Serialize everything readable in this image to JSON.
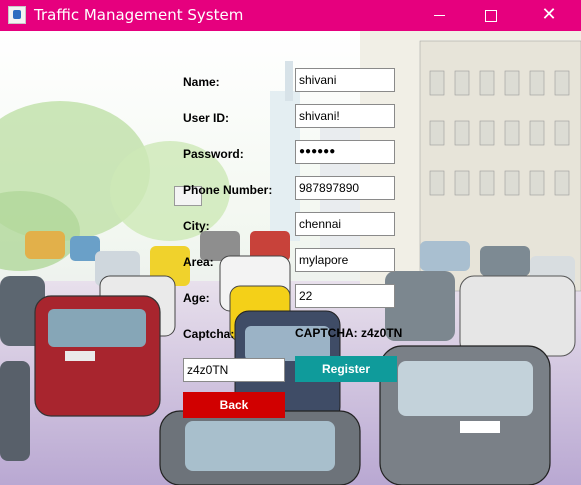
{
  "window": {
    "title": "Traffic Management System",
    "app_icon": "java-cup-icon",
    "controls": {
      "minimize": "minimize-icon",
      "maximize": "maximize-icon",
      "close": "close-icon",
      "close_glyph": "✕"
    },
    "title_bar_color": "#e6007e"
  },
  "form": {
    "name": {
      "label": "Name:",
      "value": "shivani"
    },
    "user_id": {
      "label": "User ID:",
      "value": "shivani!"
    },
    "password": {
      "label": "Password:",
      "value": "●●●●●●"
    },
    "phone": {
      "label": "Phone Number:",
      "value": "987897890"
    },
    "city": {
      "label": "City:",
      "value": "chennai"
    },
    "area": {
      "label": "Area:",
      "value": "mylapore"
    },
    "age": {
      "label": "Age:",
      "value": "22"
    },
    "captcha": {
      "label": "Captcha:",
      "display": "CAPTCHA: z4z0TN",
      "input_value": "z4z0TN"
    }
  },
  "buttons": {
    "register": {
      "label": "Register",
      "color": "#0f9b9b"
    },
    "back": {
      "label": "Back",
      "color": "#d10000"
    }
  }
}
